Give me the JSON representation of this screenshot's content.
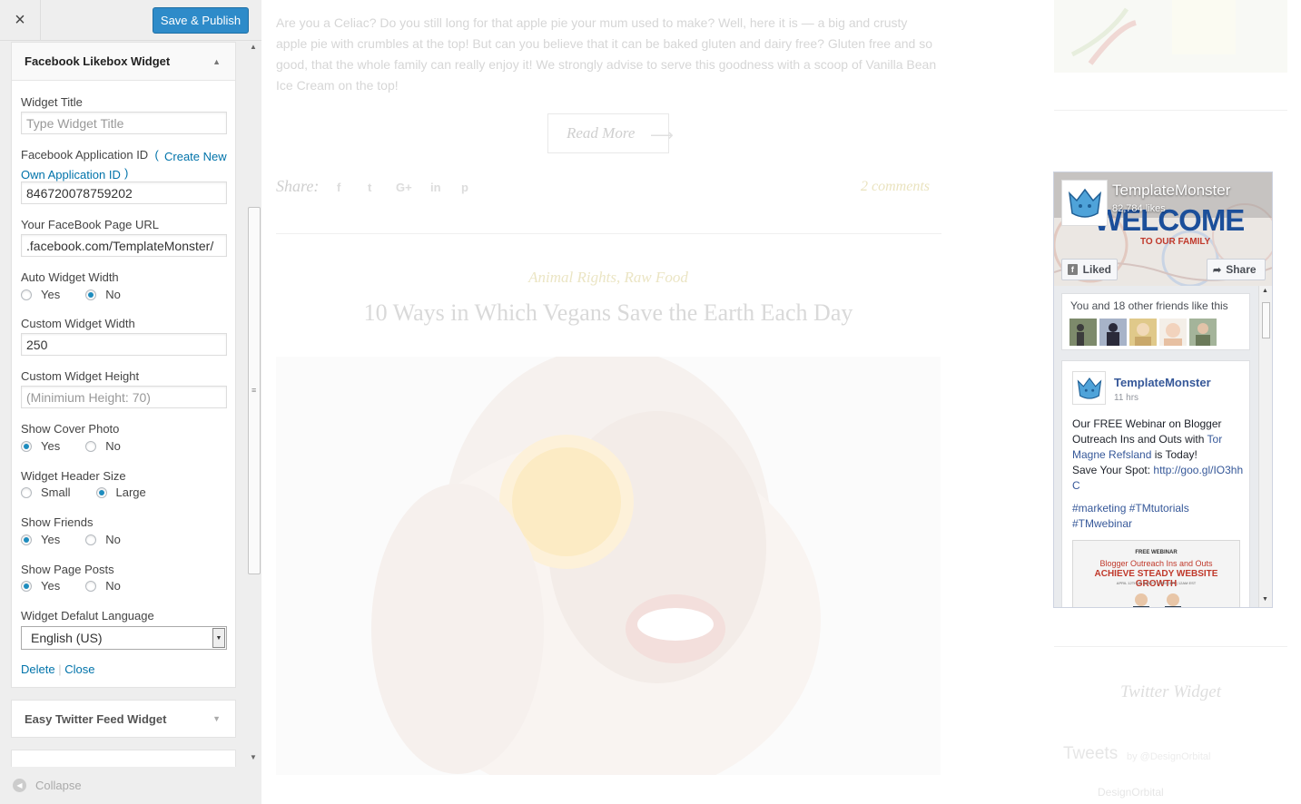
{
  "sidebar": {
    "close_icon": "×",
    "publish_label": "Save & Publish",
    "collapse_label": "Collapse",
    "fb_widget": {
      "title": "Facebook Likebox Widget",
      "fields": {
        "widget_title_label": "Widget Title",
        "widget_title_placeholder": "Type Widget Title",
        "app_id_label": "Facebook Application ID",
        "app_id_link_open": "(",
        "app_id_link": "Create New Own Application ID",
        "app_id_link_close": ")",
        "app_id_value": "846720078759202",
        "page_url_label": "Your FaceBook Page URL",
        "page_url_value": ".facebook.com/TemplateMonster/",
        "auto_width_label": "Auto Widget Width",
        "custom_width_label": "Custom Widget Width",
        "custom_width_value": "250",
        "custom_height_label": "Custom Widget Height",
        "custom_height_placeholder": "(Minimium Height: 70)",
        "cover_label": "Show Cover Photo",
        "header_size_label": "Widget Header Size",
        "show_friends_label": "Show Friends",
        "show_posts_label": "Show Page Posts",
        "language_label": "Widget Defalut Language",
        "language_value": "English (US)"
      },
      "options": {
        "yes": "Yes",
        "no": "No",
        "small": "Small",
        "large": "Large"
      },
      "selected": {
        "auto_width": "No",
        "cover": "Yes",
        "header_size": "Large",
        "friends": "Yes",
        "posts": "Yes"
      },
      "delete_label": "Delete",
      "separator": "|",
      "close_label": "Close"
    },
    "twitter_widget_title": "Easy Twitter Feed Widget"
  },
  "preview": {
    "excerpt": "Are you a Celiac? Do you still long for that apple pie your mum used to make? Well, here it is — a big and crusty apple pie with crumbles at the top! But can you believe that it can be baked gluten and dairy free? Gluten free and so good, that the whole family can really enjoy it! We strongly advise to serve this goodness with a scoop of Vanilla Bean Ice Cream on the top!",
    "read_more": "Read More",
    "share_label": "Share:",
    "share_icons": [
      "f",
      "t",
      "G+",
      "in",
      "p"
    ],
    "comments": "2 comments",
    "categories": "Animal Rights, Raw Food",
    "post_title": "10 Ways in Which Vegans Save the Earth Each Day",
    "twitter_widget_title": "Twitter Widget",
    "tweets_label": "Tweets",
    "tweets_by": "by @DesignOrbital",
    "tweet_user": "DesignOrbital"
  },
  "facebook_box": {
    "page_name": "TemplateMonster",
    "likes": "82,784 likes",
    "cover_welcome": "WELCOME",
    "cover_family": "TO OUR FAMILY",
    "liked_label": "Liked",
    "share_label": "Share",
    "friends_text": "You and 18 other friends like this",
    "post": {
      "author": "TemplateMonster",
      "time": "11 hrs",
      "text_1": "Our FREE Webinar on Blogger Outreach Ins and Outs with ",
      "link_name": "Tor Magne Refsland",
      "text_2": " is Today!",
      "text_3": "Save Your Spot: ",
      "link_url": "http://goo.gl/IO3hhC",
      "tags": "#marketing #TMtutorials #TMwebinar",
      "image_line_1": "FREE WEBINAR",
      "image_line_2": "Blogger Outreach Ins and Outs",
      "image_line_3": "ACHIEVE STEADY WEBSITE GROWTH",
      "image_line_4": "APRIL 12TH AT 9AM PT | 5PM GMT | 12AM EST"
    }
  }
}
